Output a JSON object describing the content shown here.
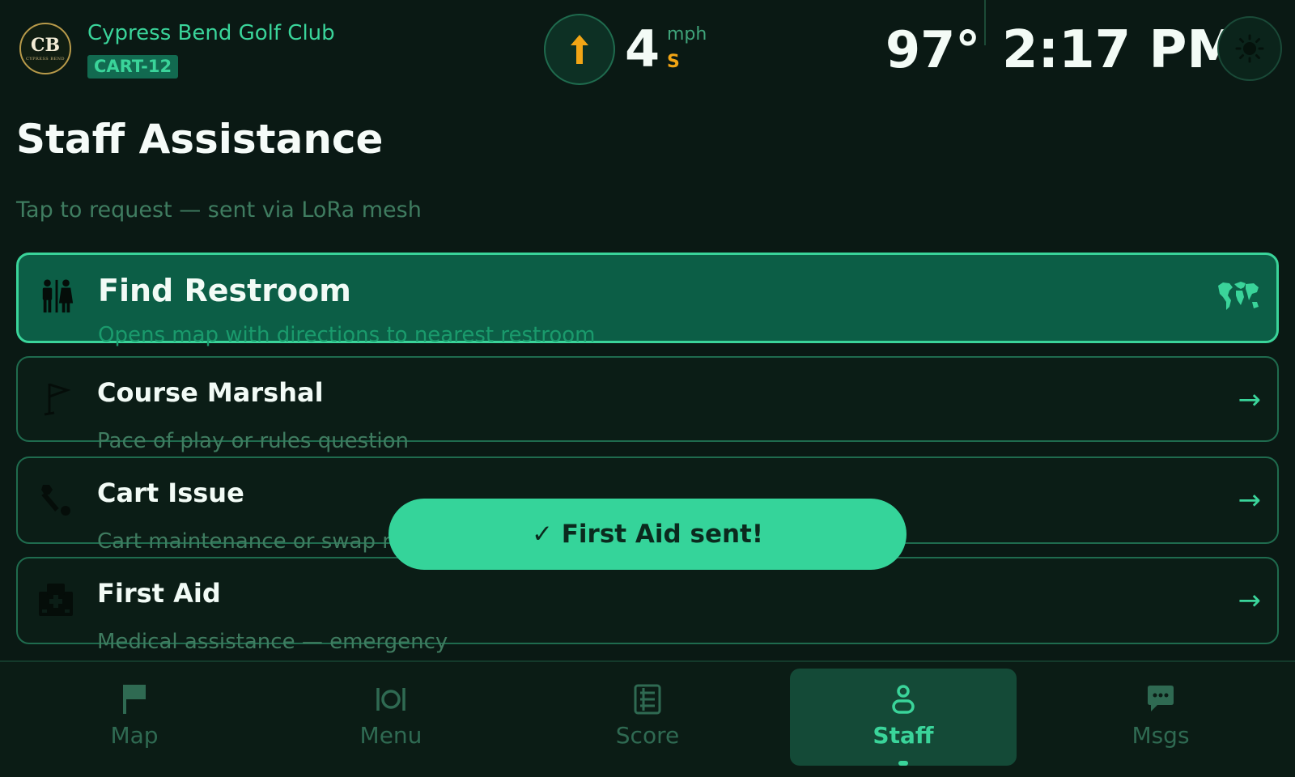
{
  "header": {
    "logo": {
      "monogram": "CB",
      "caption": "CYPRESS BEND"
    },
    "club_name": "Cypress Bend Golf Club",
    "cart_id": "CART-12",
    "heading_icon": "arrow-up-icon",
    "speed": {
      "value": "4",
      "unit": "mph",
      "direction": "S"
    },
    "temperature": "97°",
    "time": "2:17 PM",
    "theme_icon": "sun-icon"
  },
  "page": {
    "title": "Staff Assistance",
    "subtitle": "Tap to request — sent via LoRa mesh"
  },
  "services": [
    {
      "title": "Find Restroom",
      "subtitle": "Opens map with directions to nearest restroom",
      "icon": "restroom-icon",
      "trailing_icon": "world-map-icon",
      "active": true
    },
    {
      "title": "Course Marshal",
      "subtitle": "Pace of play or rules question",
      "icon": "golf-flag-icon",
      "trailing": "→"
    },
    {
      "title": "Cart Issue",
      "subtitle": "Cart maintenance or swap request",
      "icon": "wrench-icon",
      "trailing": "→"
    },
    {
      "title": "First Aid",
      "subtitle": "Medical assistance — emergency",
      "icon": "hospital-icon",
      "trailing": "→"
    }
  ],
  "toast": {
    "message": "✓ First Aid sent!"
  },
  "nav": [
    {
      "label": "Map",
      "icon": "flag-icon"
    },
    {
      "label": "Menu",
      "icon": "dining-icon"
    },
    {
      "label": "Score",
      "icon": "scorecard-icon"
    },
    {
      "label": "Staff",
      "icon": "person-icon",
      "active": true
    },
    {
      "label": "Msgs",
      "icon": "chat-icon"
    }
  ],
  "colors": {
    "background": "#0a1914",
    "accent": "#3ad49a",
    "active_card": "#0c5e46",
    "heading_arrow": "#f2a515",
    "muted_text": "#3f7c60"
  }
}
